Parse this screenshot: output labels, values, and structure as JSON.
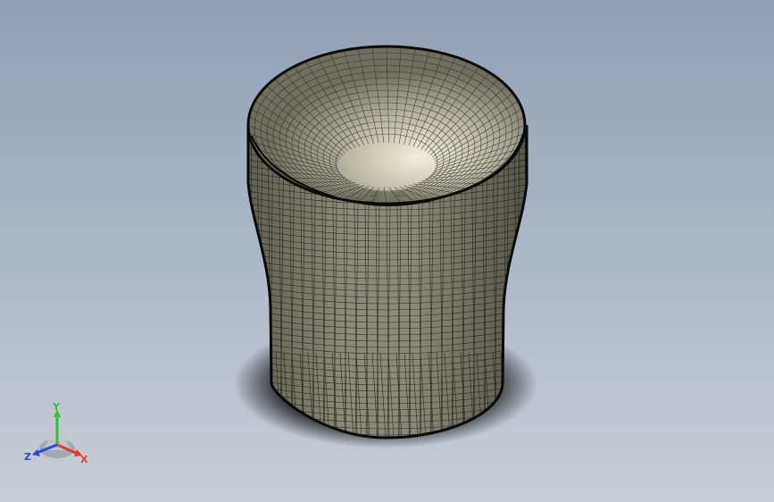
{
  "viewport": {
    "model": "vase-mesh",
    "colors": {
      "background_top": "#8fa0b6",
      "background_bottom": "#c9ced6",
      "body": "#7a796a",
      "interior": "#b4b29b",
      "highlight": "#f2f0dc",
      "edge": "#111111",
      "shadow": "#000000"
    }
  },
  "triad": {
    "x_label": "X",
    "y_label": "Y",
    "z_label": "Z",
    "x_color": "#e23a2e",
    "y_color": "#2fbf3a",
    "z_color": "#2b4bd9"
  }
}
